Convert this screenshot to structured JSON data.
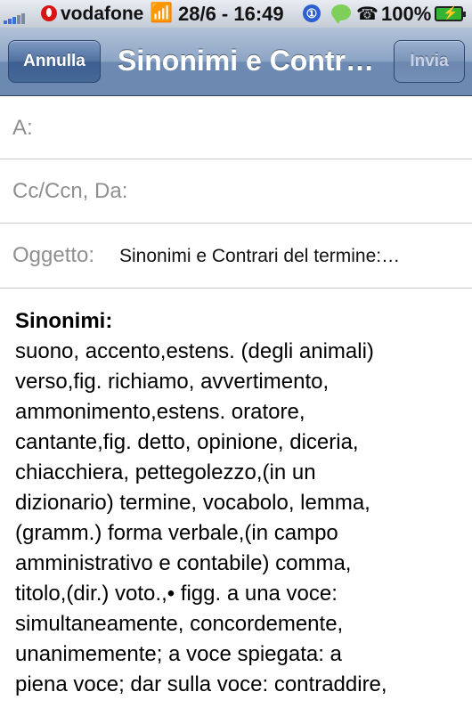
{
  "status": {
    "carrier": "vodafone",
    "time": "28/6 - 16:49",
    "battery": "100%",
    "icons": [
      "signal-icon",
      "vodafone-icon",
      "wifi-icon",
      "alarm-icon",
      "message-icon",
      "phone-icon",
      "battery-icon"
    ],
    "alarm_glyph": "①"
  },
  "nav": {
    "cancel": "Annulla",
    "title": "Sinonimi e Contr…",
    "send": "Invia"
  },
  "fields": {
    "to_label": "A:",
    "cc_label": "Cc/Ccn, Da:",
    "subject_label": "Oggetto:",
    "subject_value": "Sinonimi e Contrari del termine:…"
  },
  "body": {
    "heading": "Sinonimi:",
    "lines": [
      "suono, accento,estens. (degli animali)",
      "verso,fig. richiamo, avvertimento,",
      "ammonimento,estens. oratore,",
      "cantante,fig. detto, opinione, diceria,",
      "chiacchiera, pettegolezzo,(in un",
      "dizionario) termine, vocabolo, lemma,",
      "(gramm.) forma verbale,(in campo",
      "amministrativo e contabile) comma,",
      "titolo,(dir.) voto.,• figg. a una voce:",
      "simultaneamente, concordemente,",
      "unanimemente; a voce spiegata: a",
      "piena voce; dar sulla voce: contraddire,"
    ]
  },
  "colors": {
    "nav_bar": "#6d8ab2",
    "label_gray": "#8f8f8f",
    "battery_green": "#33b533",
    "carrier_red": "#d81414"
  }
}
